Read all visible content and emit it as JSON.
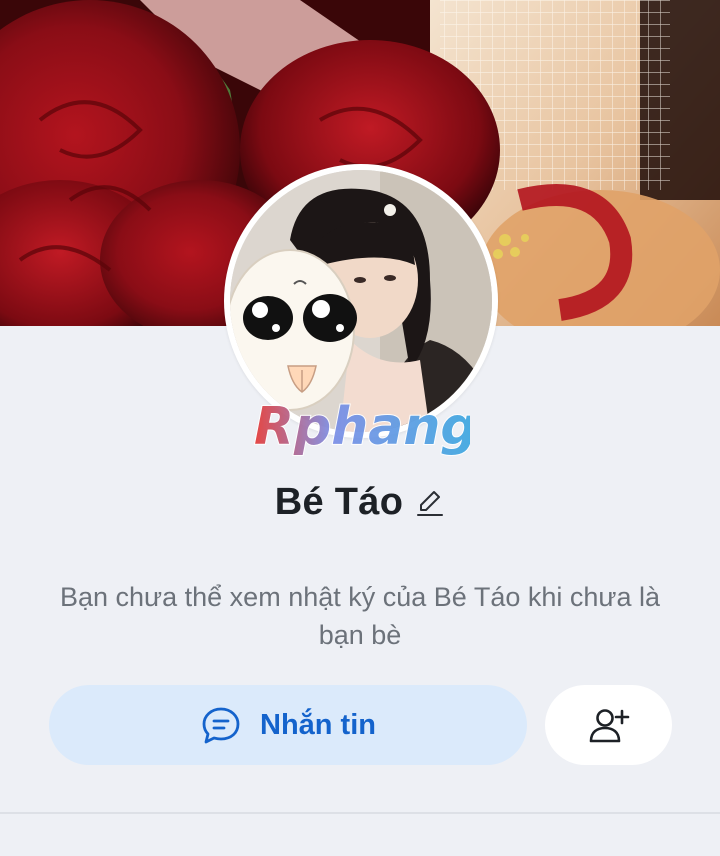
{
  "profile": {
    "name": "Bé Táo",
    "notice": "Bạn chưa thể xem nhật ký của Bé Táo khi chưa là bạn bè",
    "watermark": "Rphang"
  },
  "actions": {
    "message_label": "Nhắn tin",
    "add_friend_icon": "add-user-icon",
    "message_icon": "chat-bubble-icon",
    "edit_icon": "pencil-icon"
  },
  "colors": {
    "accent": "#1463cc",
    "message_button_bg": "#dbeafb",
    "page_bg": "#eef0f5",
    "name_text": "#1d2126",
    "notice_text": "#6c727a"
  }
}
